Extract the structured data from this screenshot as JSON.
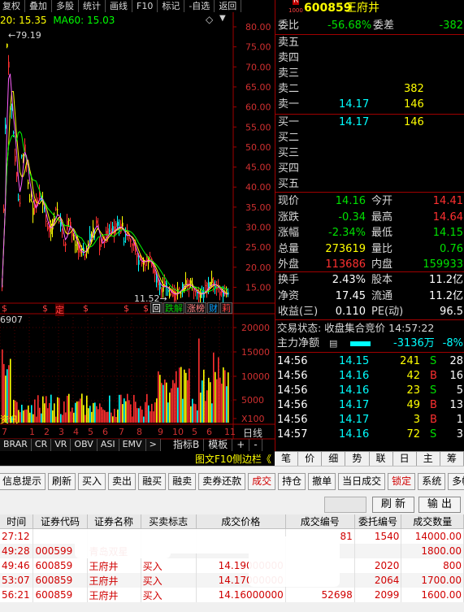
{
  "toolbar": [
    "复权",
    "叠加",
    "多股",
    "统计",
    "画线",
    "F10",
    "标记",
    "-自选",
    "返回"
  ],
  "chart": {
    "ma20": "20: 15.35",
    "ma60": "MA60: 15.03",
    "high_mark": "79.19",
    "low_mark": "11.52",
    "price_ticks": [
      "80.00",
      "75.00",
      "70.00",
      "65.00",
      "60.00",
      "55.00",
      "50.00",
      "45.00",
      "40.00",
      "35.00",
      "30.00",
      "25.00",
      "20.00",
      "15.00"
    ],
    "vol_label": "6907",
    "vol_ticks": [
      "20000",
      "15000",
      "10000",
      "5000",
      "X100"
    ],
    "markers": [
      "$",
      "$",
      "定",
      "$",
      "$",
      "$"
    ],
    "badges": [
      "回",
      "跌解",
      "涨榜",
      "财",
      "莉"
    ],
    "bottom_left": "资讯",
    "xticks": [
      "7",
      "1",
      "2",
      "3",
      "4",
      "5",
      "6",
      "7",
      "8",
      "9",
      "10",
      "5",
      "6",
      "1",
      "1"
    ],
    "timeframe": "日线",
    "indicators": [
      "BRAR",
      "CR",
      "VR",
      "OBV",
      "ASI",
      "EMV",
      ">"
    ],
    "sub_tabs": [
      "指标B",
      "模板",
      "+",
      "-"
    ],
    "f10_link": "图文F10",
    "side_link": "侧边栏《"
  },
  "quote": {
    "code": "600859",
    "name": "王府井",
    "rz": "R",
    "code_badge": "1000",
    "wb_label": "委比",
    "wb_value": "-56.68%",
    "wc_label": "委差",
    "wc_value": "-382",
    "sell": [
      {
        "label": "卖五",
        "price": "",
        "vol": ""
      },
      {
        "label": "卖四",
        "price": "",
        "vol": ""
      },
      {
        "label": "卖三",
        "price": "",
        "vol": ""
      },
      {
        "label": "卖二",
        "price": "",
        "vol": "382"
      },
      {
        "label": "卖一",
        "price": "14.17",
        "vol": "146"
      }
    ],
    "buy": [
      {
        "label": "买一",
        "price": "14.17",
        "vol": "146"
      },
      {
        "label": "买二",
        "price": "",
        "vol": ""
      },
      {
        "label": "买三",
        "price": "",
        "vol": ""
      },
      {
        "label": "买四",
        "price": "",
        "vol": ""
      },
      {
        "label": "买五",
        "price": "",
        "vol": ""
      }
    ],
    "stats": [
      {
        "l1": "现价",
        "v1": "14.16",
        "l2": "今开",
        "v2": "14.41"
      },
      {
        "l1": "涨跌",
        "v1": "-0.34",
        "l2": "最高",
        "v2": "14.64"
      },
      {
        "l1": "涨幅",
        "v1": "-2.34%",
        "l2": "最低",
        "v2": "14.15"
      },
      {
        "l1": "总量",
        "v1": "273619",
        "l2": "量比",
        "v2": "0.76"
      },
      {
        "l1": "外盘",
        "v1": "113686",
        "l2": "内盘",
        "v2": "159933"
      }
    ],
    "stats2": [
      {
        "l1": "换手",
        "v1": "2.43%",
        "l2": "股本",
        "v2": "11.2亿"
      },
      {
        "l1": "净资",
        "v1": "17.45",
        "l2": "流通",
        "v2": "11.2亿"
      },
      {
        "l1": "收益(三)",
        "v1": "0.110",
        "l2": "PE(动)",
        "v2": "96.5"
      }
    ],
    "status": "交易状态: 收盘集合竞价 14:57:22",
    "main_flow_label": "主力净额",
    "main_flow_value": "-3136万",
    "main_flow_pct": "-8%",
    "ticks": [
      {
        "t": "14:56",
        "p": "14.15",
        "v": "241",
        "s": "S",
        "n": "28"
      },
      {
        "t": "14:56",
        "p": "14.16",
        "v": "42",
        "s": "B",
        "n": "16"
      },
      {
        "t": "14:56",
        "p": "14.16",
        "v": "23",
        "s": "S",
        "n": "5"
      },
      {
        "t": "14:56",
        "p": "14.17",
        "v": "49",
        "s": "B",
        "n": "13"
      },
      {
        "t": "14:56",
        "p": "14.17",
        "v": "3",
        "s": "B",
        "n": "1"
      },
      {
        "t": "14:57",
        "p": "14.16",
        "v": "72",
        "s": "S",
        "n": "3"
      }
    ],
    "tabs": [
      "笔",
      "价",
      "细",
      "势",
      "联",
      "日",
      "主",
      "筹"
    ]
  },
  "trade": {
    "buttons": [
      "信息提示",
      "刷新",
      "买入",
      "卖出",
      "融买",
      "融卖",
      "卖券还款",
      "成交",
      "持仓",
      "撤单",
      "当日成交",
      "锁定",
      "系统",
      "多帐号"
    ],
    "btn_refresh": "刷 新",
    "btn_export": "输 出",
    "headers": [
      "时间",
      "证券代码",
      "证券名称",
      "买卖标志",
      "成交价格",
      "成交编号",
      "委托编号",
      "成交数量"
    ],
    "rows": [
      {
        "time": "27:12",
        "code": "",
        "name": "",
        "flag": "",
        "price": "",
        "deal": "81",
        "order": "1540",
        "qty": "14000.00"
      },
      {
        "time": "49:28",
        "code": "000599",
        "name": "青岛双星",
        "flag": "",
        "price": "",
        "deal": "",
        "order": "",
        "qty": "1800.00"
      },
      {
        "time": "49:46",
        "code": "600859",
        "name": "王府井",
        "flag": "买入",
        "price": "14.19000000",
        "deal": "",
        "order": "2020",
        "qty": "800"
      },
      {
        "time": "53:07",
        "code": "600859",
        "name": "王府井",
        "flag": "买入",
        "price": "14.17000000",
        "deal": "",
        "order": "2064",
        "qty": "1700.00"
      },
      {
        "time": "56:21",
        "code": "600859",
        "name": "王府井",
        "flag": "买入",
        "price": "14.16000000",
        "deal": "52698",
        "order": "2099",
        "qty": "1600.00"
      }
    ]
  }
}
